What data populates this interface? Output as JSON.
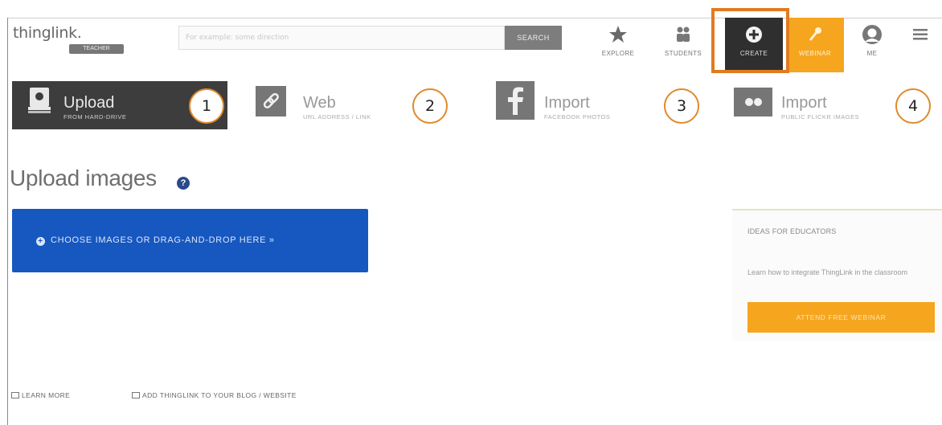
{
  "header": {
    "logo_text": "thinglink.",
    "logo_badge": "TEACHER",
    "search_placeholder": "For example: some direction",
    "search_button": "SEARCH",
    "nav": [
      {
        "label": "EXPLORE",
        "icon": "star-icon"
      },
      {
        "label": "STUDENTS",
        "icon": "students-icon"
      },
      {
        "label": "CREATE",
        "icon": "plus-circle-icon"
      },
      {
        "label": "WEBINAR",
        "icon": "pin-icon"
      },
      {
        "label": "ME",
        "icon": "avatar-icon"
      },
      {
        "label": "",
        "icon": "hamburger-menu-icon"
      }
    ]
  },
  "tabs": [
    {
      "title": "Upload",
      "subtitle": "FROM HARD-DRIVE",
      "icon": "hard-drive-icon",
      "number": "1"
    },
    {
      "title": "Web",
      "subtitle": "URL ADDRESS / LINK",
      "icon": "link-icon",
      "number": "2"
    },
    {
      "title": "Import",
      "subtitle": "FACEBOOK PHOTOS",
      "icon": "facebook-icon",
      "number": "3"
    },
    {
      "title": "Import",
      "subtitle": "PUBLIC FLICKR IMAGES",
      "icon": "flickr-icon",
      "number": "4"
    }
  ],
  "main": {
    "heading": "Upload images",
    "help_icon_glyph": "?",
    "choose_button": "CHOOSE IMAGES OR DRAG-AND-DROP HERE »"
  },
  "panel": {
    "title": "IDEAS FOR EDUCATORS",
    "text": "Learn how to integrate ThingLink in the classroom",
    "button": "ATTEND FREE WEBINAR"
  },
  "footer": {
    "learn_more": "LEARN MORE",
    "add_thinglink": "ADD THINGLINK TO YOUR BLOG / WEBSITE"
  },
  "colors": {
    "accent_orange": "#f6a51e",
    "highlight_orange": "#e07b1f",
    "primary_blue": "#1657c0",
    "dark_tab": "#3d3d3d"
  }
}
